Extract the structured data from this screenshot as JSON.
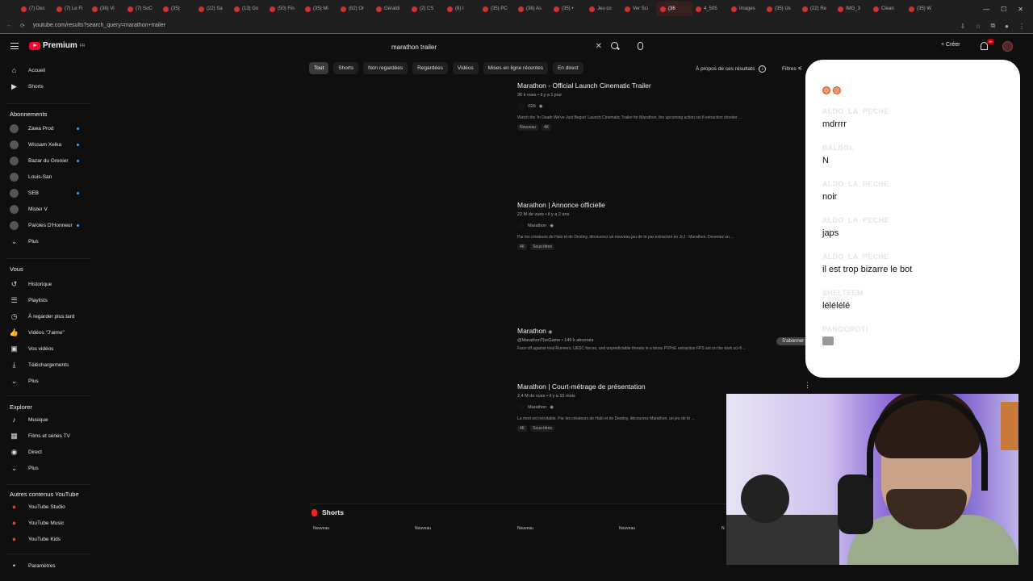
{
  "browser": {
    "tabs": [
      "(7) Dec",
      "(7) Le Fi",
      "(36) Vi",
      "(7) SoC",
      "(35)",
      "(22) Sa",
      "(13) Go",
      "(50) Fin",
      "(35) Mi",
      "(62) Or",
      "Géraldi",
      "(2) CS",
      "(8) I",
      "(35) PC",
      "(36) As",
      "(35) •",
      "Jeu co",
      "Ver Sci",
      "(36",
      "4_505",
      "Images",
      "(35) Us",
      "(22) Re",
      "IMG_3",
      "Clean",
      "(35) W"
    ],
    "url": "youtube.com/results?search_query=marathon+trailer"
  },
  "header": {
    "logo_text": "Premium",
    "logo_sup": "FR",
    "search_value": "marathon trailer",
    "create_label": "Créer",
    "notif_count": "9+"
  },
  "sidebar": {
    "main": [
      {
        "label": "Accueil",
        "icon": "home-icon"
      },
      {
        "label": "Shorts",
        "icon": "shorts-icon"
      }
    ],
    "subs_heading": "Abonnements",
    "subs": [
      {
        "label": "Zawa Prod",
        "dot": true
      },
      {
        "label": "Wissam Xelka",
        "dot": true
      },
      {
        "label": "Bazar du Grenier",
        "dot": true
      },
      {
        "label": "Louis-San",
        "dot": false
      },
      {
        "label": "SEB",
        "dot": true
      },
      {
        "label": "Mister V",
        "dot": false
      },
      {
        "label": "Paroles D'Honneur",
        "dot": true
      },
      {
        "label": "Plus",
        "dot": false
      }
    ],
    "you_heading": "Vous",
    "you": [
      {
        "label": "Historique"
      },
      {
        "label": "Playlists"
      },
      {
        "label": "À regarder plus tard"
      },
      {
        "label": "Vidéos \"J'aime\""
      },
      {
        "label": "Vos vidéos"
      },
      {
        "label": "Téléchargements"
      },
      {
        "label": "Plus"
      }
    ],
    "explore_heading": "Explorer",
    "explore": [
      {
        "label": "Musique"
      },
      {
        "label": "Films et séries TV"
      },
      {
        "label": "Direct"
      },
      {
        "label": "Plus"
      }
    ],
    "other_heading": "Autres contenus YouTube",
    "other": [
      {
        "label": "YouTube Studio"
      },
      {
        "label": "YouTube Music"
      },
      {
        "label": "YouTube Kids"
      }
    ],
    "settings": "Paramètres"
  },
  "chips": [
    "Tout",
    "Shorts",
    "Non regardées",
    "Regardées",
    "Vidéos",
    "Mises en ligne récentes",
    "En direct"
  ],
  "about_results": "À propos de ces résultats",
  "filters": "Filtres",
  "results": [
    {
      "title": "Marathon - Official Launch Cinematic Trailer",
      "meta": "36 k vues • il y a 1 jour",
      "channel": "IGN",
      "desc": "Watch the 'In Death We've Just Begun' Launch Cinematic Trailer for Marathon, the upcoming action sci-fi extraction shooter ...",
      "tags": [
        "Nouveau",
        "4K"
      ]
    },
    {
      "title": "Marathon | Annonce officielle",
      "meta": "22 M de vues • il y a 2 ans",
      "channel": "Marathon",
      "desc": "Par les créateurs de Halo et de Destiny, découvrez un nouveau jeu de tir par extraction en JcJ : Marathon.   Devenez un ...",
      "tags": [
        "4K",
        "Sous-titres"
      ]
    },
    {
      "title": "Marathon",
      "meta": "@MarathonTheGame • 149 k abonnés",
      "desc": "Face off against rival Runners, UESC forces, and unpredictable threats in a tense PVPvE extraction FPS set on the dark sci-fi ..."
    },
    {
      "title": "Marathon | Court-métrage de présentation",
      "meta": "2,4 M de vues • il y a 10 mois",
      "channel": "Marathon",
      "desc": "La mort est inévitable. Par les créateurs de Halo et de Destiny, découvrez Marathon, un jeu de tir ...",
      "tags": [
        "4K",
        "Sous-titres"
      ]
    }
  ],
  "subscribe_label": "S'abonner",
  "shorts_section": {
    "title": "Shorts",
    "labels": [
      "Nouveau",
      "Nouveau",
      "Nouveau",
      "Nouveau",
      "N"
    ]
  },
  "chat": [
    {
      "user": "",
      "text": ""
    },
    {
      "user": "ALDO_LA_PECHE",
      "text": "mdrrrr"
    },
    {
      "user": "BALBOL",
      "text": "N"
    },
    {
      "user": "ALDO_LA_PECHE",
      "text": "noir"
    },
    {
      "user": "ALDO_LA_PECHE",
      "text": "japs"
    },
    {
      "user": "ALDO_LA_PECHE",
      "text": "il est trop bizarre le bot"
    },
    {
      "user": "SHELTEEM",
      "text": "lélélélé"
    },
    {
      "user": "PANGOROTI",
      "text": ""
    }
  ],
  "colors": {
    "accent": "#ff0033",
    "background": "#0f0f0f",
    "chat_bg": "#ffffff"
  }
}
